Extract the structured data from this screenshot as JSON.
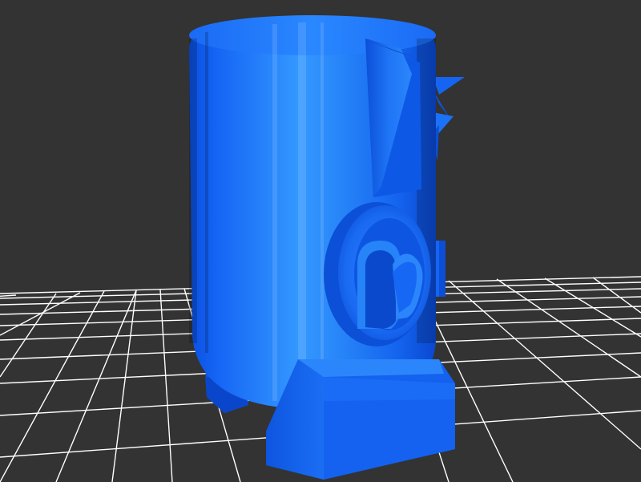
{
  "scene": {
    "background_color": "#333333",
    "grid_color": "#ffffff",
    "model_color": "#1f6fff",
    "model_highlight_color": "#3a9bff",
    "model_shadow_color": "#0a45d4",
    "icons": [
      "ground-grid",
      "3d-model"
    ]
  }
}
